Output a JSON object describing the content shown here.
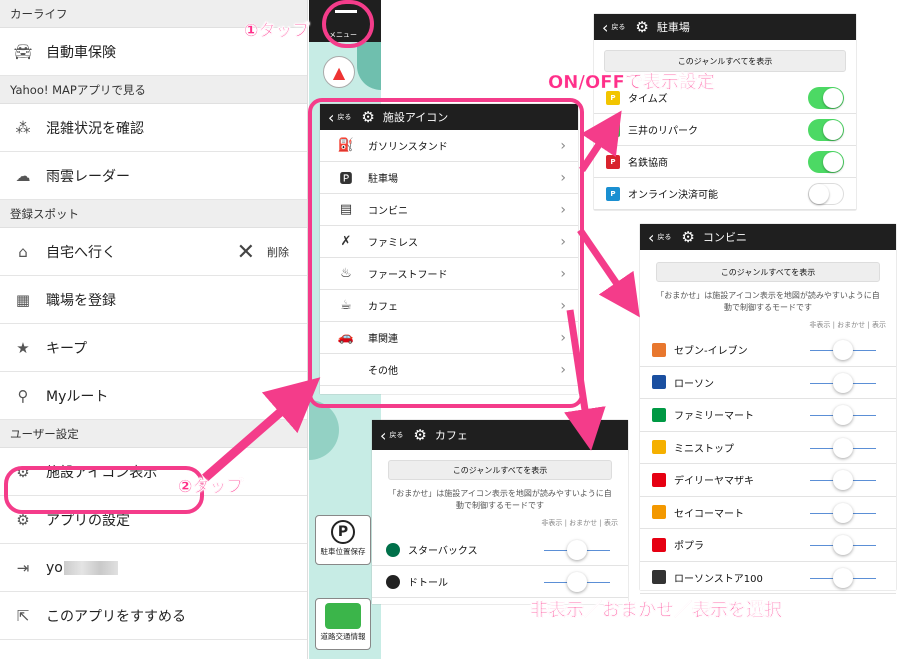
{
  "menu": {
    "sections": {
      "carlife": "カーライフ",
      "yahoo": "Yahoo! MAPアプリで見る",
      "spots": "登録スポット",
      "user": "ユーザー設定"
    },
    "items": {
      "car_insurance": "自動車保険",
      "congestion": "混雑状況を確認",
      "rain_radar": "雨雲レーダー",
      "home": "自宅へ行く",
      "delete": "削除",
      "work": "職場を登録",
      "keep": "キープ",
      "my_route": "Myルート",
      "facility_icon": "施設アイコン表示",
      "app_settings": "アプリの設定",
      "account_prefix": "yo",
      "recommend": "このアプリをすすめる"
    }
  },
  "map": {
    "menu_label": "メニュー",
    "parking_save": "駐車位置保存",
    "traffic": "道路交通情報"
  },
  "facility_panel": {
    "back": "戻る",
    "title": "施設アイコン",
    "items": [
      "ガソリンスタンド",
      "駐車場",
      "コンビニ",
      "ファミレス",
      "ファーストフード",
      "カフェ",
      "車関連",
      "その他"
    ]
  },
  "parking_panel": {
    "back": "戻る",
    "title": "駐車場",
    "show_all": "このジャンルすべてを表示",
    "items": [
      {
        "label": "タイムズ",
        "on": true
      },
      {
        "label": "三井のリパーク",
        "on": true
      },
      {
        "label": "名鉄協商",
        "on": true
      },
      {
        "label": "オンライン決済可能",
        "on": false
      }
    ]
  },
  "conv_panel": {
    "back": "戻る",
    "title": "コンビニ",
    "show_all": "このジャンルすべてを表示",
    "note": "「おまかせ」は施設アイコン表示を地図が読みやすいように自動で制御するモードです",
    "modes": "非表示 | おまかせ | 表示",
    "items": [
      "セブン-イレブン",
      "ローソン",
      "ファミリーマート",
      "ミニストップ",
      "デイリーヤマザキ",
      "セイコーマート",
      "ポプラ",
      "ローソンストア100"
    ]
  },
  "cafe_panel": {
    "back": "戻る",
    "title": "カフェ",
    "show_all": "このジャンルすべてを表示",
    "note": "「おまかせ」は施設アイコン表示を地図が読みやすいように自動で制御するモードです",
    "modes": "非表示 | おまかせ | 表示",
    "items": [
      "スターバックス",
      "ドトール"
    ]
  },
  "annotations": {
    "tap1": "①タップ",
    "tap2": "②タップ",
    "onoff": "ON/OFFで表示設定",
    "select": "非表示／おまかせ／表示を選択"
  },
  "colors": {
    "accent": "#f43c8a",
    "toggle_on": "#4cd964",
    "header": "#1f1f1f"
  }
}
